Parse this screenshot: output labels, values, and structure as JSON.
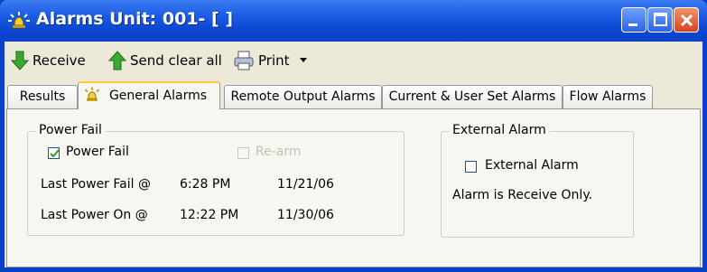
{
  "window": {
    "title": "Alarms Unit: 001- [ ]",
    "title_icon": "alarm-bell-icon",
    "controls": [
      "minimize",
      "maximize",
      "close"
    ]
  },
  "toolbar": {
    "receive_label": "Receive",
    "send_clear_all_label": "Send clear all",
    "print_label": "Print",
    "print_dropdown_icon": "caret-down-icon"
  },
  "tabs": [
    {
      "label": "Results",
      "active": false
    },
    {
      "label": "General Alarms",
      "active": true
    },
    {
      "label": "Remote Output Alarms",
      "active": false
    },
    {
      "label": "Current & User Set Alarms",
      "active": false
    },
    {
      "label": "Flow Alarms",
      "active": false
    }
  ],
  "power_fail_group": {
    "title": "Power Fail",
    "power_fail_checkbox": {
      "label": "Power Fail",
      "checked": true
    },
    "second_checkbox": {
      "label": "Re-arm",
      "checked": false,
      "disabled": true
    },
    "last_power_fail": {
      "label": "Last Power Fail @",
      "time": "6:28 PM",
      "date": "11/21/06"
    },
    "last_power_on": {
      "label": "Last Power On @",
      "time": "12:22 PM",
      "date": "11/30/06"
    }
  },
  "external_alarm_group": {
    "title": "External Alarm",
    "checkbox": {
      "label": "External Alarm",
      "checked": false
    },
    "note": "Alarm is Receive Only."
  },
  "colors": {
    "titlebar": "#0b41c6",
    "window_bg": "#ece9d8",
    "active_tab_accent": "#ffc83c",
    "close_button": "#d8431c"
  }
}
